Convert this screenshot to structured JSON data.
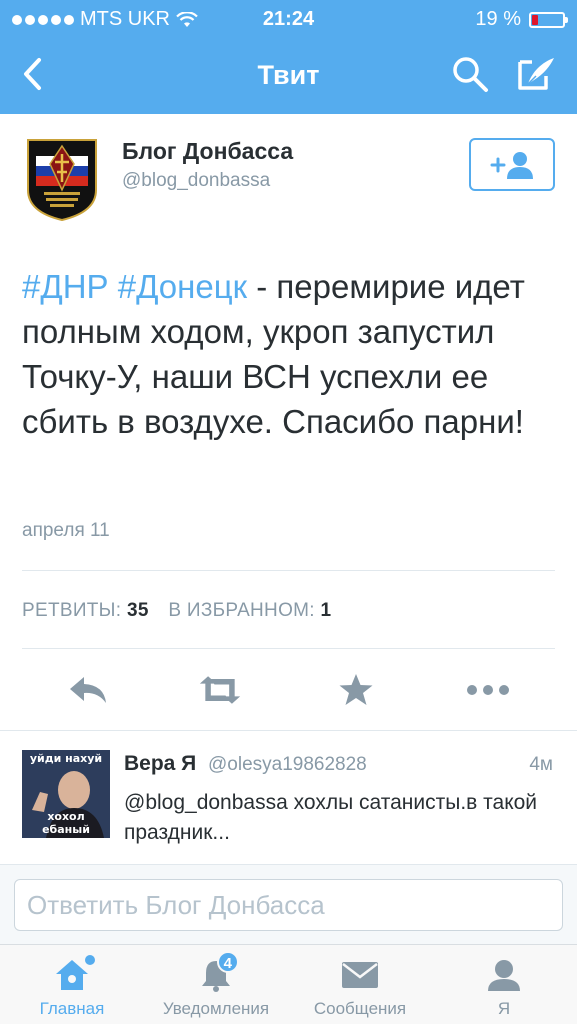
{
  "status_bar": {
    "carrier": "MTS UKR",
    "time": "21:24",
    "battery_percent": "19 %",
    "battery_level": 0.19
  },
  "nav": {
    "title": "Твит",
    "back_icon": "chevron-left-icon",
    "search_icon": "search-icon",
    "compose_icon": "compose-icon"
  },
  "tweet": {
    "author_name": "Блог Донбасса",
    "author_handle": "@blog_donbassa",
    "avatar_icon": "army-emblem-icon",
    "hashtag1": "#ДНР",
    "hashtag2": "#Донецк",
    "text_rest": " - перемирие идет полным ходом, укроп запустил Точку-У, наши ВСН успехли ее сбить в воздухе. Спасибо парни!",
    "date": "апреля 11",
    "retweets_label": "РЕТВИТЫ:",
    "retweets_count": "35",
    "favorites_label": "В ИЗБРАННОМ:",
    "favorites_count": "1"
  },
  "reply": {
    "author_name": "Вера Я",
    "author_handle": "@olesya19862828",
    "time": "4м",
    "text": "@blog_donbassa  хохлы сатанисты.в такой праздник...",
    "avatar_caption_top": "уйди нахуй",
    "avatar_caption_bottom": "хохол ебаный"
  },
  "reply_box": {
    "placeholder": "Ответить Блог Донбасса"
  },
  "tabbar": {
    "home": "Главная",
    "notifications": "Уведомления",
    "notifications_badge": "4",
    "messages": "Сообщения",
    "me": "Я"
  },
  "colors": {
    "brand": "#55acee",
    "text": "#292f33",
    "muted": "#8899a6",
    "battery_low": "#e0162b"
  }
}
